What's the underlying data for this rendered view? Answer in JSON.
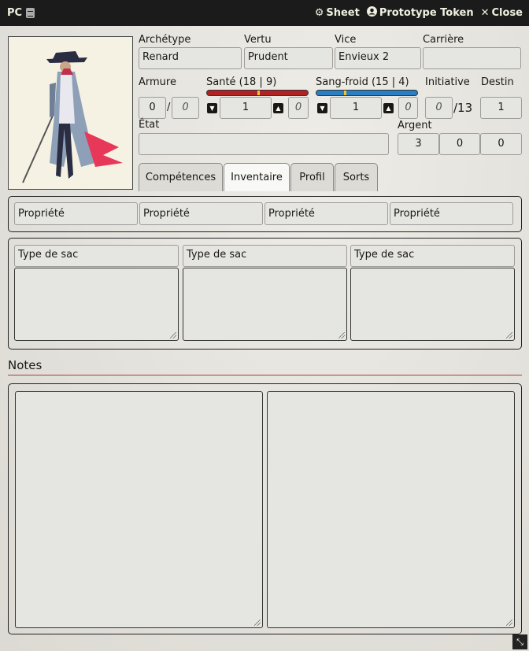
{
  "window": {
    "title": "PC",
    "actions": {
      "sheet": "Sheet",
      "token": "Prototype Token",
      "close": "Close"
    }
  },
  "header": {
    "archetype": {
      "label": "Archétype",
      "value": "Renard"
    },
    "vertu": {
      "label": "Vertu",
      "value": "Prudent"
    },
    "vice": {
      "label": "Vice",
      "value": "Envieux 2"
    },
    "carriere": {
      "label": "Carrière",
      "value": ""
    },
    "armure": {
      "label": "Armure",
      "current": "0",
      "max": "0",
      "sep": "/"
    },
    "sante": {
      "label": "Santé (18 | 9)",
      "value": "1",
      "mod": "0"
    },
    "sangfroid": {
      "label": "Sang-froid (15 | 4)",
      "value": "1",
      "mod": "0"
    },
    "initiative": {
      "label": "Initiative",
      "value": "0",
      "max": "/13"
    },
    "destin": {
      "label": "Destin",
      "value": "1"
    },
    "etat": {
      "label": "État",
      "value": ""
    },
    "argent": {
      "label": "Argent",
      "values": [
        "3",
        "0",
        "0"
      ]
    }
  },
  "tabs": [
    "Compétences",
    "Inventaire",
    "Profil",
    "Sorts"
  ],
  "inventory": {
    "properties": [
      "Propriété",
      "Propriété",
      "Propriété",
      "Propriété"
    ],
    "bags": [
      "Type de sac",
      "Type de sac",
      "Type de sac"
    ]
  },
  "notes": {
    "title": "Notes"
  },
  "colors": {
    "sante_bar": "#b22222",
    "sangfroid_bar": "#2a7fc4",
    "tick": "#f4c430",
    "notes_rule": "#a8413a"
  }
}
